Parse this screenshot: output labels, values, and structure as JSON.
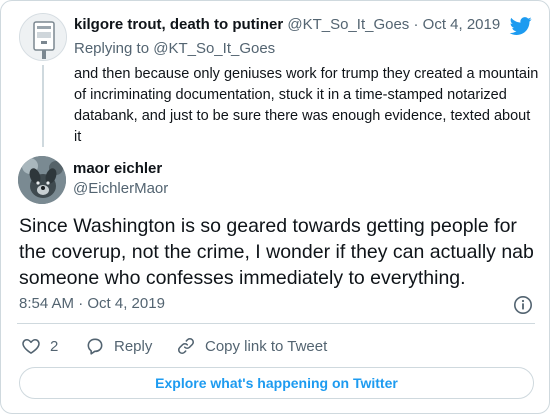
{
  "colors": {
    "accent": "#1d9bf0",
    "text": "#0f1419",
    "muted": "#536471",
    "border": "#cfd9de"
  },
  "parent_tweet": {
    "name": "kilgore trout, death to putiner",
    "handle": "@KT_So_It_Goes",
    "separator": "·",
    "date": "Oct 4, 2019",
    "replying_prefix": "Replying to",
    "replying_to": "@KT_So_It_Goes",
    "text": "and then because only geniuses work for trump they created a mountain of incriminating documentation, stuck it in a time-stamped notarized databank, and just to be sure there was enough evidence, texted about it",
    "avatar_icon": "mailbox-icon"
  },
  "tweet": {
    "name": "maor eichler",
    "handle": "@EichlerMaor",
    "text": "Since Washington is so geared towards getting people for the coverup, not the crime, I wonder if they can actually nab someone who confesses immediately to everything.",
    "time": "8:54 AM · Oct 4, 2019",
    "avatar_icon": "dog-avatar"
  },
  "actions": {
    "like_count": "2",
    "reply_label": "Reply",
    "copy_link_label": "Copy link to Tweet"
  },
  "explore_label": "Explore what's happening on Twitter",
  "brand_icon": "twitter-bird-icon"
}
